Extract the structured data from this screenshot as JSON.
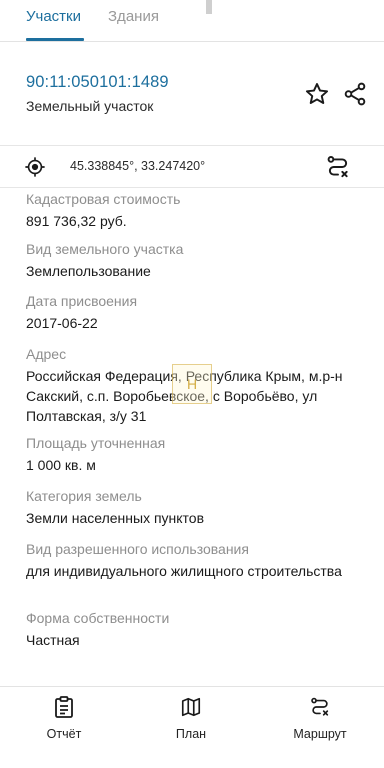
{
  "tabs": [
    {
      "label": "Участки",
      "active": true
    },
    {
      "label": "Здания",
      "active": false
    }
  ],
  "parcel": {
    "cadastral_number": "90:11:050101:1489",
    "type": "Земельный участок"
  },
  "coordinates": "45.338845°, 33.247420°",
  "fields": {
    "cost": {
      "label": "Кадастровая стоимость",
      "value": "891 736,32 руб."
    },
    "kind": {
      "label": "Вид земельного участка",
      "value": "Землепользование"
    },
    "date": {
      "label": "Дата присвоения",
      "value": "2017-06-22"
    },
    "address": {
      "label": "Адрес",
      "value": "Российская Федерация, Республика Крым, м.р-н Сакский, с.п. Воробьевское, с Воробьёво, ул Полтавская, з/у 31"
    },
    "area": {
      "label": "Площадь уточненная",
      "value": "1 000 кв. м"
    },
    "category": {
      "label": "Категория земель",
      "value": "Земли населенных пунктов"
    },
    "permitted_use": {
      "label": "Вид разрешенного использования",
      "value": "для индивидуального жилищного строительства"
    },
    "ownership": {
      "label": "Форма собственности",
      "value": "Частная"
    }
  },
  "watermark_letter": "Н",
  "bottom_nav": [
    {
      "label": "Отчёт",
      "icon": "report-icon"
    },
    {
      "label": "План",
      "icon": "map-icon"
    },
    {
      "label": "Маршрут",
      "icon": "route-icon"
    }
  ],
  "colors": {
    "accent": "#1d6f9e",
    "label": "#8e8e8e",
    "text": "#1a1a1a"
  }
}
